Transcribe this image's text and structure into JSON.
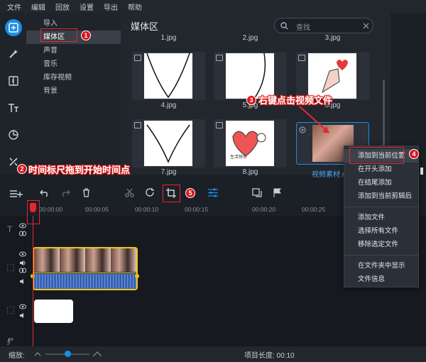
{
  "menu": [
    "文件",
    "编辑",
    "回放",
    "设置",
    "导出",
    "帮助"
  ],
  "categories": [
    "导入",
    "媒体区",
    "声音",
    "音乐",
    "库存视频",
    "背景"
  ],
  "media": {
    "title": "媒体区",
    "search_placeholder": "查找",
    "top_labels": [
      "1.jpg",
      "2.jpg",
      "3.jpg"
    ],
    "row1_labels": [
      "4.jpg",
      "5.jpg",
      "6.jpg"
    ],
    "row2_labels": [
      "7.jpg",
      "8.jpg",
      "视频素材.m"
    ],
    "thumb8_text": "生活快乐"
  },
  "context_menu": [
    "添加到当前位置",
    "在开头添加",
    "在结尾添加",
    "添加到当前剪辑后",
    "添加文件",
    "选择所有文件",
    "移除选定文件",
    "在文件夹中显示",
    "文件信息"
  ],
  "ruler_ticks": [
    "00:00:00",
    "00:00:05",
    "00:00:10",
    "00:00:15",
    "00:00:20",
    "00:00:25"
  ],
  "status": {
    "zoom_label": "缩放:",
    "zoom_value": 0.5,
    "project_length": "项目长度: 00:10"
  },
  "annotations": {
    "n1": "1",
    "n2": "2",
    "n3": "3",
    "n4": "4",
    "n5": "5",
    "note2": "时间标尺拖到开始时间点",
    "note3": "右键点击视频文件"
  },
  "colors": {
    "accent": "#1b8de6",
    "annotation_red": "#e5282d",
    "clip_border": "#f0c419"
  }
}
